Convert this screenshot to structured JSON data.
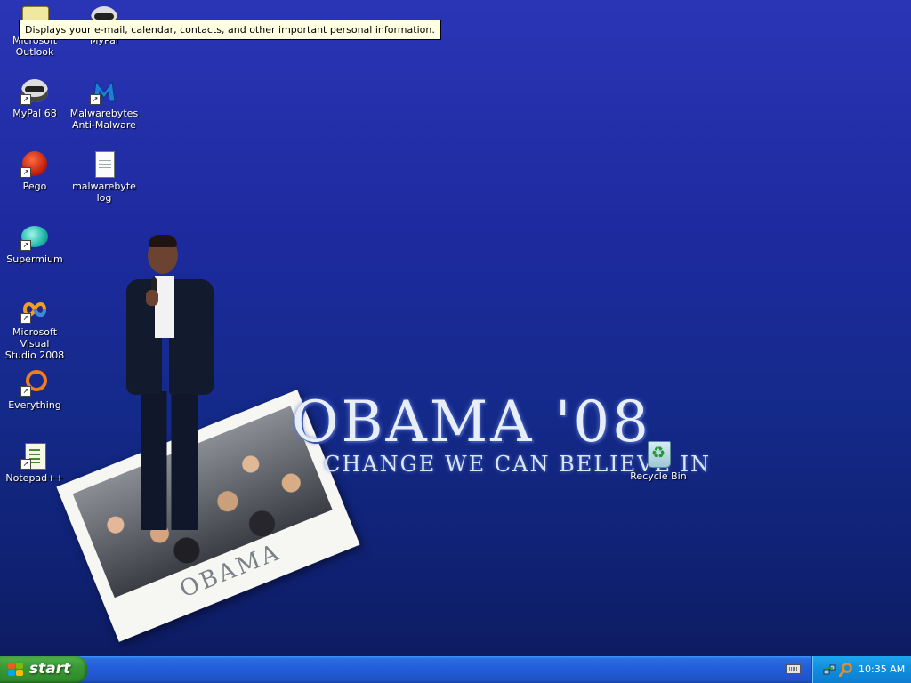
{
  "tooltip": {
    "text": "Displays your e-mail, calendar, contacts, and other important personal information."
  },
  "wallpaper": {
    "title": "OBAMA '08",
    "slogan": "CHANGE WE CAN  BELIEVE IN",
    "photo_caption": "OBAMA"
  },
  "desktop_icons": [
    {
      "label_line1": "Microsoft",
      "label_line2": "Outlook",
      "icon": "outlook-icon"
    },
    {
      "label_line1": "MyPal",
      "label_line2": "",
      "icon": "raccoon-icon"
    },
    {
      "label_line1": "MyPal 68",
      "label_line2": "",
      "icon": "raccoon-icon"
    },
    {
      "label_line1": "Malwarebytes",
      "label_line2": "Anti-Malware",
      "icon": "malwarebytes-icon"
    },
    {
      "label_line1": "Pego",
      "label_line2": "",
      "icon": "pego-icon"
    },
    {
      "label_line1": "malwarebyte",
      "label_line2": "log",
      "icon": "text-file-icon"
    },
    {
      "label_line1": "Supermium",
      "label_line2": "",
      "icon": "supermium-icon"
    },
    {
      "label_line1": "Microsoft Visual",
      "label_line2": "Studio 2008",
      "icon": "visual-studio-icon"
    },
    {
      "label_line1": "Everything",
      "label_line2": "",
      "icon": "everything-icon"
    },
    {
      "label_line1": "Notepad++",
      "label_line2": "",
      "icon": "notepad-plus-plus-icon"
    },
    {
      "label_line1": "Recycle Bin",
      "label_line2": "",
      "icon": "recycle-bin-icon"
    }
  ],
  "taskbar": {
    "start_label": "start",
    "clock": "10:35 AM",
    "tray_icons": [
      "keyboard-icon",
      "network-icon",
      "search-tray-icon"
    ]
  },
  "colors": {
    "desktop_top": "#2a35b6",
    "desktop_bottom": "#0c1a5c",
    "taskbar": "#245edb",
    "start_green": "#3a9a36",
    "tray": "#1290e0"
  }
}
